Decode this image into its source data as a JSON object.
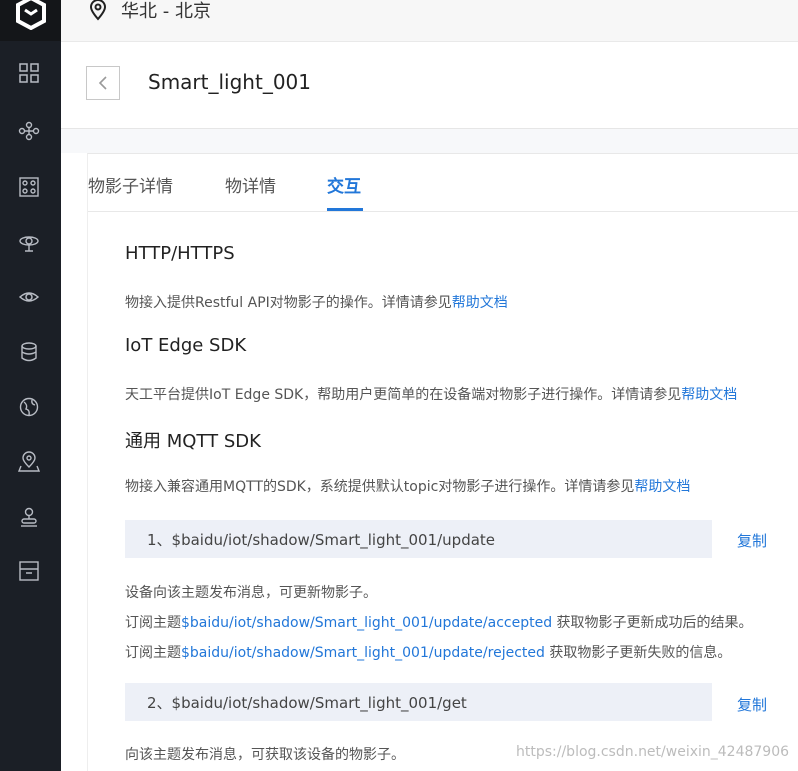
{
  "topbar": {
    "region": "华北 - 北京",
    "location_icon": "location-pin-icon"
  },
  "header": {
    "back_icon": "chevron-left-icon",
    "title": "Smart_light_001"
  },
  "sidebar": {
    "logo_icon": "cube-logo-icon",
    "icons": [
      "grid-icon",
      "nodes-icon",
      "dashboard-icon",
      "satellite-icon",
      "eye-icon",
      "database-icon",
      "globe-icon",
      "map-pin-icon",
      "edge-device-icon",
      "storage-box-icon"
    ]
  },
  "tabs": [
    {
      "label": "物影子详情"
    },
    {
      "label": "物详情"
    },
    {
      "label": "交互",
      "active": true
    }
  ],
  "sections": {
    "http": {
      "title": "HTTP/HTTPS",
      "desc": "物接入提供Restful API对物影子的操作。详情请参见",
      "link": "帮助文档"
    },
    "sdk": {
      "title": "IoT Edge SDK",
      "desc": "天工平台提供IoT Edge SDK，帮助用户更简单的在设备端对物影子进行操作。详情请参见",
      "link": "帮助文档"
    },
    "mqtt": {
      "title": "通用 MQTT SDK",
      "desc": "物接入兼容通用MQTT的SDK，系统提供默认topic对物影子进行操作。详情请参见",
      "link": "帮助文档"
    }
  },
  "topics": [
    {
      "text": "1、$baidu/iot/shadow/Smart_light_001/update",
      "copy": "复制",
      "line1": "设备向该主题发布消息，可更新物影子。",
      "line2_pre": "订阅主题",
      "line2_link": "$baidu/iot/shadow/Smart_light_001/update/accepted",
      "line2_post": " 获取物影子更新成功后的结果。",
      "line3_pre": "订阅主题",
      "line3_link": "$baidu/iot/shadow/Smart_light_001/update/rejected",
      "line3_post": " 获取物影子更新失败的信息。"
    },
    {
      "text": "2、$baidu/iot/shadow/Smart_light_001/get",
      "copy": "复制",
      "line1": "向该主题发布消息，可获取该设备的物影子。"
    }
  ],
  "watermark": "https://blog.csdn.net/weixin_42487906",
  "colors": {
    "accent": "#2277d9",
    "sidebar": "#1b1f26",
    "topic_bg": "#edf0f7"
  }
}
